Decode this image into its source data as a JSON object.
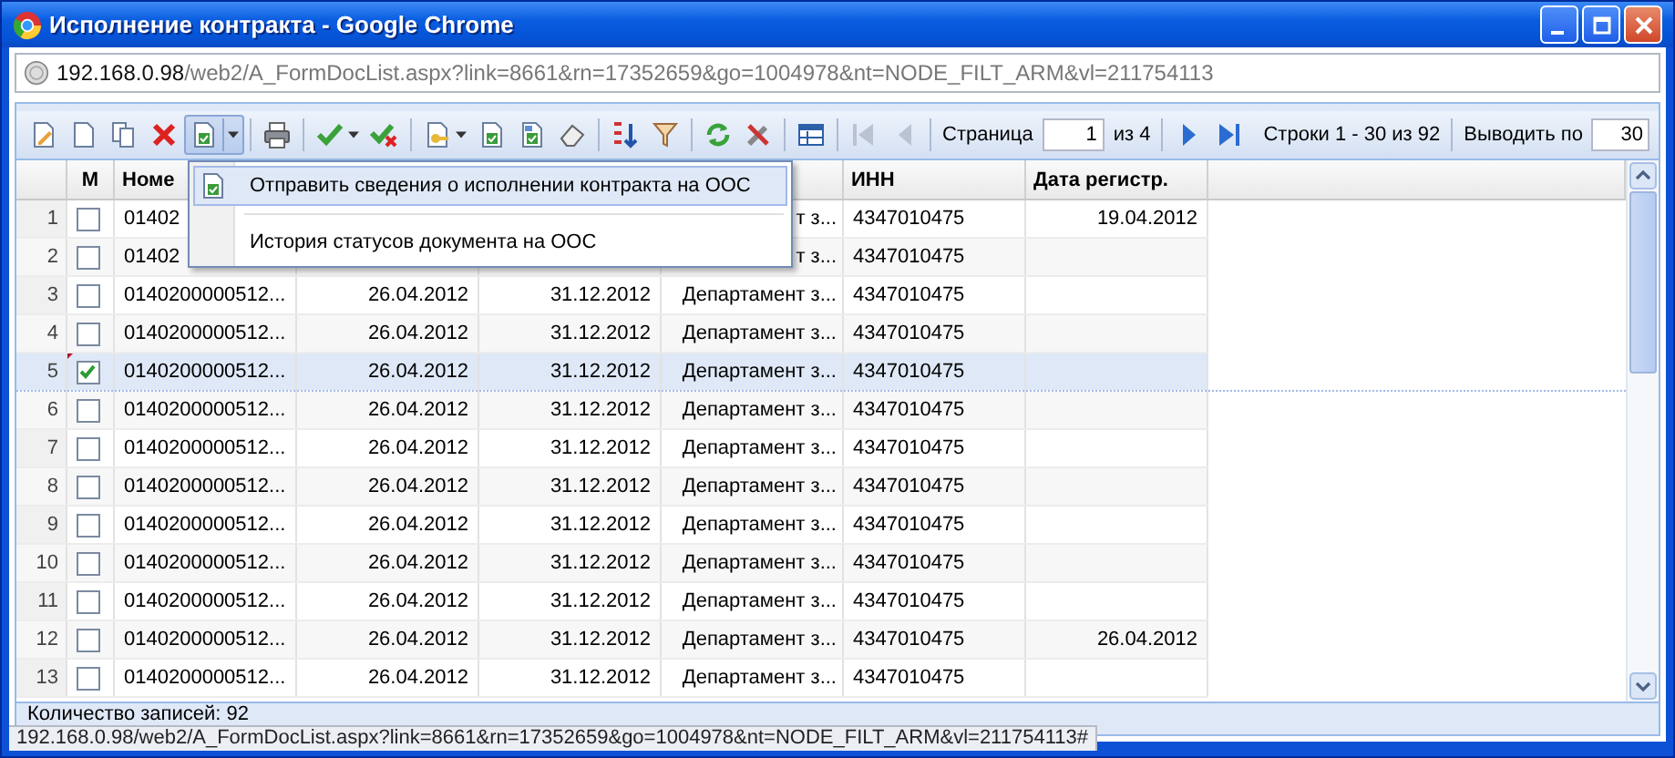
{
  "window": {
    "title": "Исполнение контракта - Google Chrome"
  },
  "address": {
    "host": "192.168.0.98",
    "path": "/web2/A_FormDocList.aspx?link=8661&rn=17352659&go=1004978&nt=NODE_FILT_ARM&vl=211754113"
  },
  "toolbar": {
    "send_menu_expanded": true
  },
  "pager": {
    "label": "Страница",
    "page": "1",
    "of": "из 4",
    "rows": "Строки 1 - 30 из 92",
    "per_page_label": "Выводить по",
    "per_page": "30",
    "nav": [
      {
        "kind": "first",
        "disabled": true
      },
      {
        "kind": "prev",
        "disabled": true
      },
      {
        "kind": "next",
        "disabled": false
      },
      {
        "kind": "last",
        "disabled": false
      }
    ]
  },
  "table": {
    "mark_column": {
      "label": "М"
    },
    "columns": [
      {
        "label": "Номе"
      },
      {},
      {},
      {},
      {
        "label": "ИНН"
      },
      {
        "label": "Дата регистр."
      }
    ],
    "rows": [
      {
        "n": "1",
        "checked": false,
        "selected": false,
        "modified": false,
        "cells": [
          "01402",
          null,
          null,
          "т з...",
          "4347010475",
          "19.04.2012"
        ]
      },
      {
        "n": "2",
        "checked": false,
        "selected": false,
        "modified": false,
        "cells": [
          "01402",
          null,
          null,
          "т з...",
          "4347010475",
          null
        ]
      },
      {
        "n": "3",
        "checked": false,
        "selected": false,
        "modified": false,
        "cells": [
          "0140200000512...",
          "26.04.2012",
          "31.12.2012",
          "Департамент з...",
          "4347010475",
          null
        ]
      },
      {
        "n": "4",
        "checked": false,
        "selected": false,
        "modified": false,
        "cells": [
          "0140200000512...",
          "26.04.2012",
          "31.12.2012",
          "Департамент з...",
          "4347010475",
          null
        ]
      },
      {
        "n": "5",
        "checked": true,
        "selected": true,
        "modified": true,
        "cells": [
          "0140200000512...",
          "26.04.2012",
          "31.12.2012",
          "Департамент з...",
          "4347010475",
          null
        ]
      },
      {
        "n": "6",
        "checked": false,
        "selected": false,
        "modified": false,
        "cells": [
          "0140200000512...",
          "26.04.2012",
          "31.12.2012",
          "Департамент з...",
          "4347010475",
          null
        ]
      },
      {
        "n": "7",
        "checked": false,
        "selected": false,
        "modified": false,
        "cells": [
          "0140200000512...",
          "26.04.2012",
          "31.12.2012",
          "Департамент з...",
          "4347010475",
          null
        ]
      },
      {
        "n": "8",
        "checked": false,
        "selected": false,
        "modified": false,
        "cells": [
          "0140200000512...",
          "26.04.2012",
          "31.12.2012",
          "Департамент з...",
          "4347010475",
          null
        ]
      },
      {
        "n": "9",
        "checked": false,
        "selected": false,
        "modified": false,
        "cells": [
          "0140200000512...",
          "26.04.2012",
          "31.12.2012",
          "Департамент з...",
          "4347010475",
          null
        ]
      },
      {
        "n": "10",
        "checked": false,
        "selected": false,
        "modified": false,
        "cells": [
          "0140200000512...",
          "26.04.2012",
          "31.12.2012",
          "Департамент з...",
          "4347010475",
          null
        ]
      },
      {
        "n": "11",
        "checked": false,
        "selected": false,
        "modified": false,
        "cells": [
          "0140200000512...",
          "26.04.2012",
          "31.12.2012",
          "Департамент з...",
          "4347010475",
          null
        ]
      },
      {
        "n": "12",
        "checked": false,
        "selected": false,
        "modified": false,
        "cells": [
          "0140200000512...",
          "26.04.2012",
          "31.12.2012",
          "Департамент з...",
          "4347010475",
          "26.04.2012"
        ]
      },
      {
        "n": "13",
        "checked": false,
        "selected": false,
        "modified": false,
        "cells": [
          "0140200000512...",
          "26.04.2012",
          "31.12.2012",
          "Департамент з...",
          "4347010475",
          null
        ]
      }
    ]
  },
  "menu": {
    "items": [
      {
        "label": "Отправить сведения о исполнении контракта на ООС",
        "selected": true,
        "kind": "icon"
      },
      {
        "label": "История статусов документа на ООС",
        "selected": false,
        "kind": "plain"
      }
    ]
  },
  "footer": {
    "count": "Количество записей: 92"
  },
  "status_bubble": "192.168.0.98/web2/A_FormDocList.aspx?link=8661&rn=17352659&go=1004978&nt=NODE_FILT_ARM&vl=211754113#"
}
